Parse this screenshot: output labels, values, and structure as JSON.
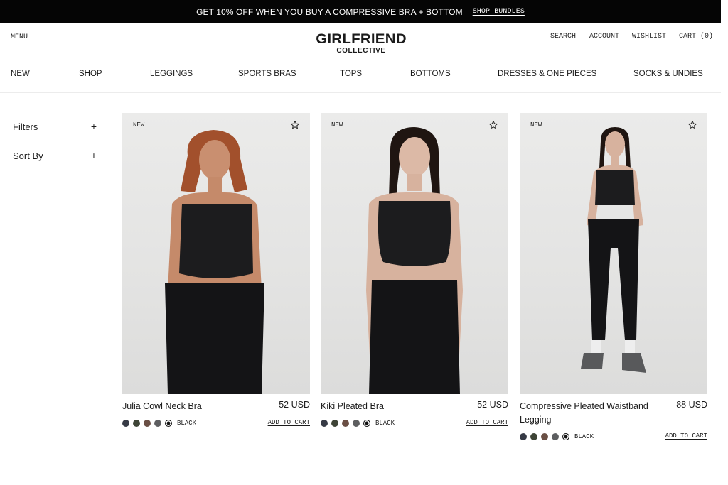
{
  "promo": {
    "text": "GET 10% OFF WHEN YOU BUY A COMPRESSIVE BRA + BOTTOM",
    "link": "SHOP BUNDLES"
  },
  "header": {
    "menu": "MENU",
    "logo_line1": "GIRLFRIEND",
    "logo_line2": "COLLECTIVE",
    "search": "SEARCH",
    "account": "ACCOUNT",
    "wishlist": "WISHLIST",
    "cart": "CART (0)"
  },
  "nav": [
    "NEW",
    "SHOP",
    "LEGGINGS",
    "SPORTS BRAS",
    "TOPS",
    "BOTTOMS",
    "DRESSES & ONE PIECES",
    "SOCKS & UNDIES"
  ],
  "sidebar": {
    "filters": "Filters",
    "sort": "Sort By",
    "plus": "+"
  },
  "products": [
    {
      "badge": "NEW",
      "name": "Julia Cowl Neck Bra",
      "price": "52 USD",
      "color_label": "BLACK",
      "add_to_cart": "ADD TO CART",
      "swatches": [
        "#363a45",
        "#3e4436",
        "#6a4f44",
        "#5d5e60",
        "#111111"
      ],
      "hair": "#a2502c"
    },
    {
      "badge": "NEW",
      "name": "Kiki Pleated Bra",
      "price": "52 USD",
      "color_label": "BLACK",
      "add_to_cart": "ADD TO CART",
      "swatches": [
        "#363a45",
        "#3e4436",
        "#6a4f44",
        "#5d5e60",
        "#111111"
      ],
      "hair": "#1f1511"
    },
    {
      "badge": "NEW",
      "name": "Compressive Pleated Waistband Legging",
      "price": "88 USD",
      "color_label": "BLACK",
      "add_to_cart": "ADD TO CART",
      "swatches": [
        "#363a45",
        "#3e4436",
        "#6a4f44",
        "#5d5e60",
        "#111111"
      ],
      "hair": "#1f1511"
    }
  ],
  "icons": {
    "star": "star-outline-icon",
    "plus": "plus-icon"
  }
}
